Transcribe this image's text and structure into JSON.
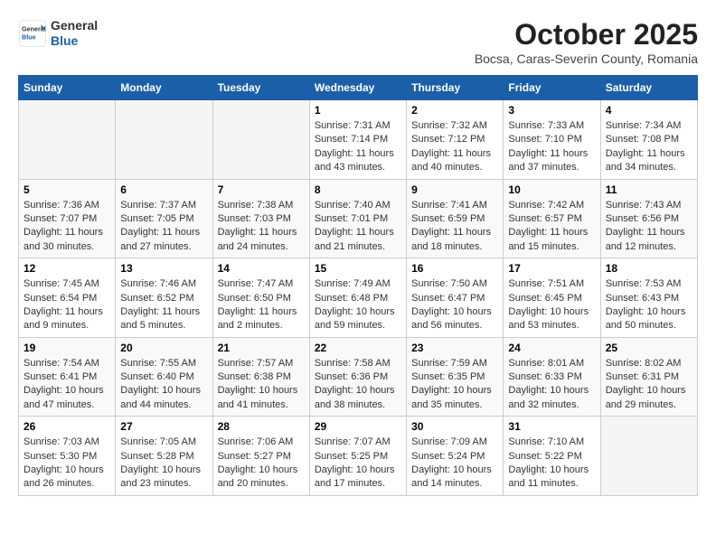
{
  "header": {
    "logo": {
      "general": "General",
      "blue": "Blue"
    },
    "title": "October 2025",
    "subtitle": "Bocsa, Caras-Severin County, Romania"
  },
  "weekdays": [
    "Sunday",
    "Monday",
    "Tuesday",
    "Wednesday",
    "Thursday",
    "Friday",
    "Saturday"
  ],
  "weeks": [
    [
      {
        "day": "",
        "info": ""
      },
      {
        "day": "",
        "info": ""
      },
      {
        "day": "",
        "info": ""
      },
      {
        "day": "1",
        "info": "Sunrise: 7:31 AM\nSunset: 7:14 PM\nDaylight: 11 hours and 43 minutes."
      },
      {
        "day": "2",
        "info": "Sunrise: 7:32 AM\nSunset: 7:12 PM\nDaylight: 11 hours and 40 minutes."
      },
      {
        "day": "3",
        "info": "Sunrise: 7:33 AM\nSunset: 7:10 PM\nDaylight: 11 hours and 37 minutes."
      },
      {
        "day": "4",
        "info": "Sunrise: 7:34 AM\nSunset: 7:08 PM\nDaylight: 11 hours and 34 minutes."
      }
    ],
    [
      {
        "day": "5",
        "info": "Sunrise: 7:36 AM\nSunset: 7:07 PM\nDaylight: 11 hours and 30 minutes."
      },
      {
        "day": "6",
        "info": "Sunrise: 7:37 AM\nSunset: 7:05 PM\nDaylight: 11 hours and 27 minutes."
      },
      {
        "day": "7",
        "info": "Sunrise: 7:38 AM\nSunset: 7:03 PM\nDaylight: 11 hours and 24 minutes."
      },
      {
        "day": "8",
        "info": "Sunrise: 7:40 AM\nSunset: 7:01 PM\nDaylight: 11 hours and 21 minutes."
      },
      {
        "day": "9",
        "info": "Sunrise: 7:41 AM\nSunset: 6:59 PM\nDaylight: 11 hours and 18 minutes."
      },
      {
        "day": "10",
        "info": "Sunrise: 7:42 AM\nSunset: 6:57 PM\nDaylight: 11 hours and 15 minutes."
      },
      {
        "day": "11",
        "info": "Sunrise: 7:43 AM\nSunset: 6:56 PM\nDaylight: 11 hours and 12 minutes."
      }
    ],
    [
      {
        "day": "12",
        "info": "Sunrise: 7:45 AM\nSunset: 6:54 PM\nDaylight: 11 hours and 9 minutes."
      },
      {
        "day": "13",
        "info": "Sunrise: 7:46 AM\nSunset: 6:52 PM\nDaylight: 11 hours and 5 minutes."
      },
      {
        "day": "14",
        "info": "Sunrise: 7:47 AM\nSunset: 6:50 PM\nDaylight: 11 hours and 2 minutes."
      },
      {
        "day": "15",
        "info": "Sunrise: 7:49 AM\nSunset: 6:48 PM\nDaylight: 10 hours and 59 minutes."
      },
      {
        "day": "16",
        "info": "Sunrise: 7:50 AM\nSunset: 6:47 PM\nDaylight: 10 hours and 56 minutes."
      },
      {
        "day": "17",
        "info": "Sunrise: 7:51 AM\nSunset: 6:45 PM\nDaylight: 10 hours and 53 minutes."
      },
      {
        "day": "18",
        "info": "Sunrise: 7:53 AM\nSunset: 6:43 PM\nDaylight: 10 hours and 50 minutes."
      }
    ],
    [
      {
        "day": "19",
        "info": "Sunrise: 7:54 AM\nSunset: 6:41 PM\nDaylight: 10 hours and 47 minutes."
      },
      {
        "day": "20",
        "info": "Sunrise: 7:55 AM\nSunset: 6:40 PM\nDaylight: 10 hours and 44 minutes."
      },
      {
        "day": "21",
        "info": "Sunrise: 7:57 AM\nSunset: 6:38 PM\nDaylight: 10 hours and 41 minutes."
      },
      {
        "day": "22",
        "info": "Sunrise: 7:58 AM\nSunset: 6:36 PM\nDaylight: 10 hours and 38 minutes."
      },
      {
        "day": "23",
        "info": "Sunrise: 7:59 AM\nSunset: 6:35 PM\nDaylight: 10 hours and 35 minutes."
      },
      {
        "day": "24",
        "info": "Sunrise: 8:01 AM\nSunset: 6:33 PM\nDaylight: 10 hours and 32 minutes."
      },
      {
        "day": "25",
        "info": "Sunrise: 8:02 AM\nSunset: 6:31 PM\nDaylight: 10 hours and 29 minutes."
      }
    ],
    [
      {
        "day": "26",
        "info": "Sunrise: 7:03 AM\nSunset: 5:30 PM\nDaylight: 10 hours and 26 minutes."
      },
      {
        "day": "27",
        "info": "Sunrise: 7:05 AM\nSunset: 5:28 PM\nDaylight: 10 hours and 23 minutes."
      },
      {
        "day": "28",
        "info": "Sunrise: 7:06 AM\nSunset: 5:27 PM\nDaylight: 10 hours and 20 minutes."
      },
      {
        "day": "29",
        "info": "Sunrise: 7:07 AM\nSunset: 5:25 PM\nDaylight: 10 hours and 17 minutes."
      },
      {
        "day": "30",
        "info": "Sunrise: 7:09 AM\nSunset: 5:24 PM\nDaylight: 10 hours and 14 minutes."
      },
      {
        "day": "31",
        "info": "Sunrise: 7:10 AM\nSunset: 5:22 PM\nDaylight: 10 hours and 11 minutes."
      },
      {
        "day": "",
        "info": ""
      }
    ]
  ]
}
